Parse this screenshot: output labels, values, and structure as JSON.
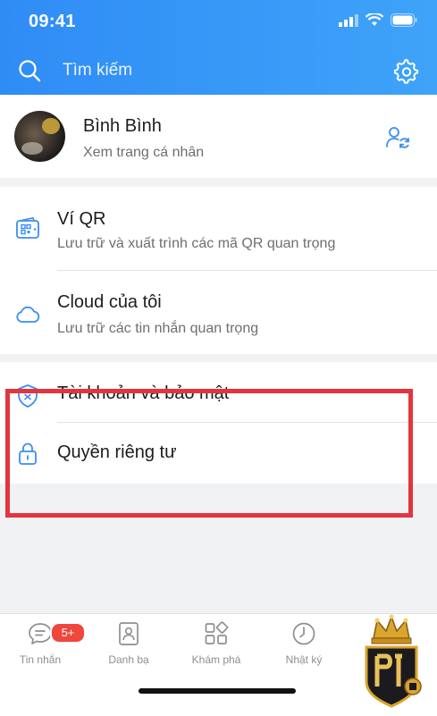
{
  "status_bar": {
    "time": "09:41"
  },
  "header": {
    "search_label": "Tìm kiếm"
  },
  "profile": {
    "name": "Bình Bình",
    "subtitle": "Xem trang cá nhân"
  },
  "menu_section_1": [
    {
      "title": "Ví QR",
      "subtitle": "Lưu trữ và xuất trình các mã QR quan trọng",
      "icon": "qr-wallet-icon"
    },
    {
      "title": "Cloud của tôi",
      "subtitle": "Lưu trữ các tin nhắn quan trọng",
      "icon": "cloud-icon"
    }
  ],
  "menu_section_2": [
    {
      "title": "Tài khoản và bảo mật",
      "icon": "shield-icon"
    },
    {
      "title": "Quyền riêng tư",
      "icon": "lock-icon"
    }
  ],
  "tabbar": {
    "tabs": [
      {
        "label": "Tin nhắn",
        "icon": "chat-icon"
      },
      {
        "label": "Danh bạ",
        "icon": "contacts-icon"
      },
      {
        "label": "Khám phá",
        "icon": "discover-icon"
      },
      {
        "label": "Nhật ký",
        "icon": "clock-icon"
      }
    ],
    "badge": "5+"
  },
  "colors": {
    "header": "#2f8cf5",
    "highlight": "#e3343f",
    "icon_blue": "#3a8ef0"
  }
}
